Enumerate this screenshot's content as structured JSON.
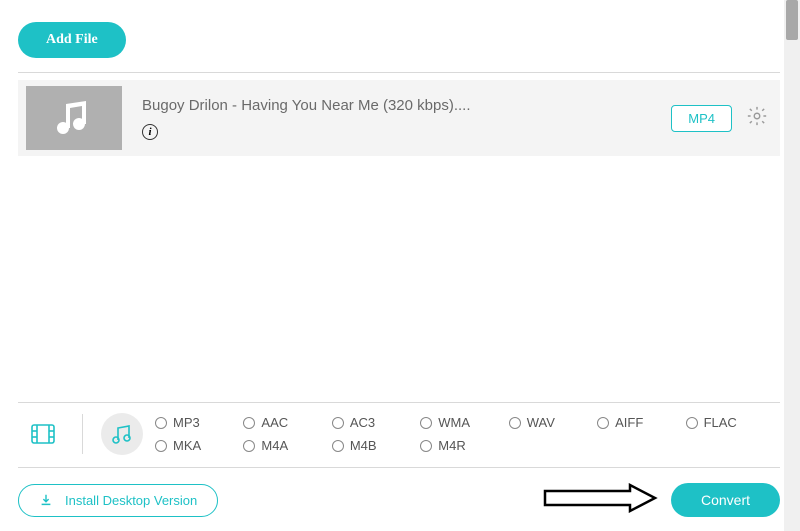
{
  "header": {
    "add_file_label": "Add File"
  },
  "file": {
    "title": "Bugoy Drilon - Having You Near Me (320 kbps)....",
    "format_badge": "MP4"
  },
  "formats": {
    "row1": [
      "MP3",
      "AAC",
      "AC3",
      "WMA",
      "WAV",
      "AIFF",
      "FLAC"
    ],
    "row2": [
      "MKA",
      "M4A",
      "M4B",
      "M4R"
    ]
  },
  "footer": {
    "install_label": "Install Desktop Version",
    "convert_label": "Convert"
  }
}
